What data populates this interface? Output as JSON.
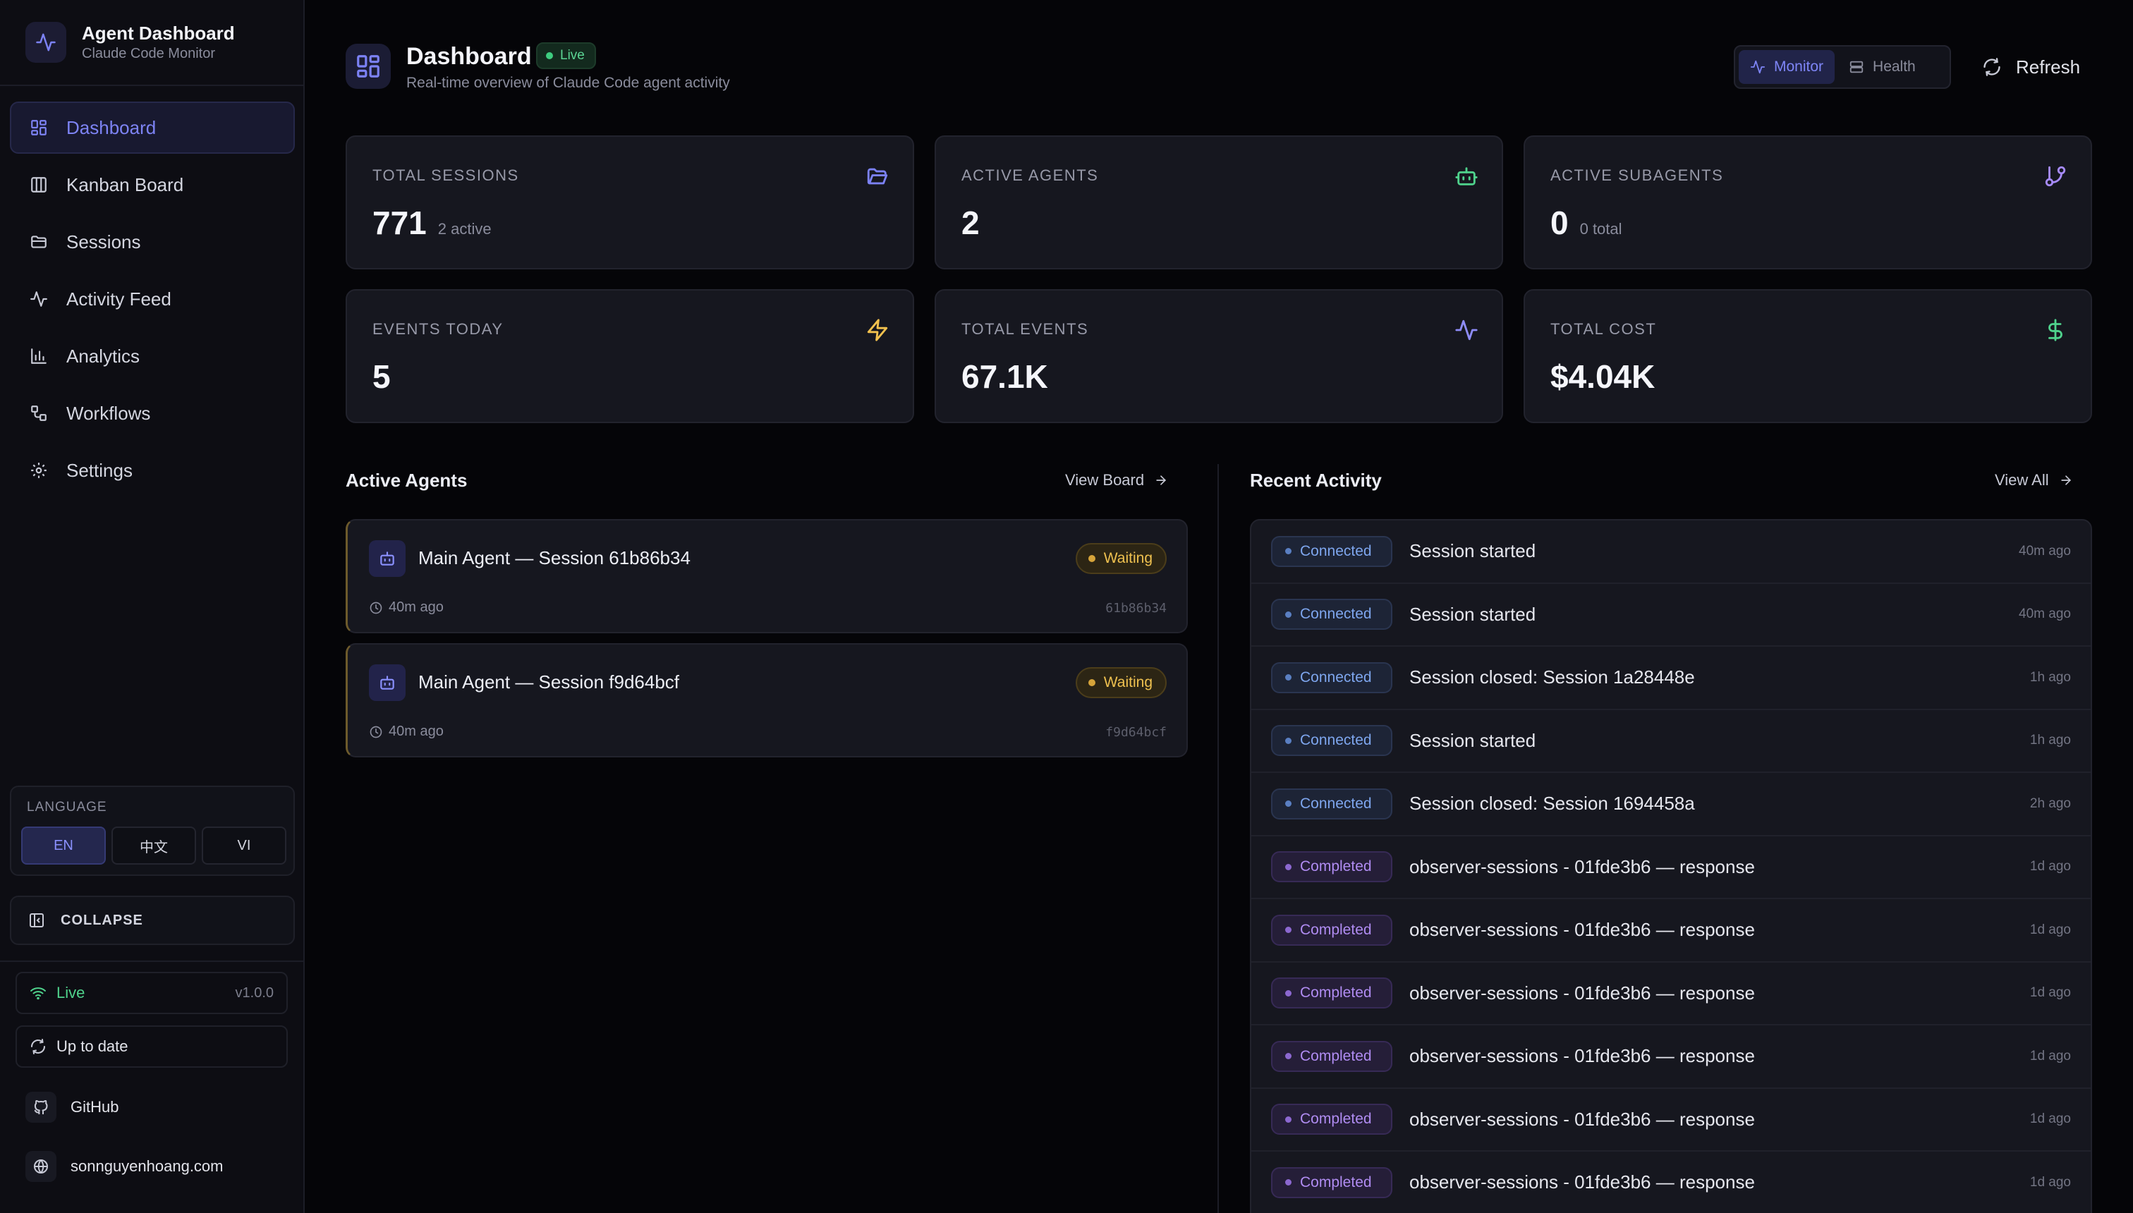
{
  "brand": {
    "title": "Agent Dashboard",
    "subtitle": "Claude Code Monitor"
  },
  "nav": [
    {
      "label": "Dashboard",
      "icon": "layout-grid-icon",
      "active": true
    },
    {
      "label": "Kanban Board",
      "icon": "columns-icon",
      "active": false
    },
    {
      "label": "Sessions",
      "icon": "folder-icon",
      "active": false
    },
    {
      "label": "Activity Feed",
      "icon": "activity-icon",
      "active": false
    },
    {
      "label": "Analytics",
      "icon": "bar-chart-icon",
      "active": false
    },
    {
      "label": "Workflows",
      "icon": "workflow-icon",
      "active": false
    },
    {
      "label": "Settings",
      "icon": "gear-icon",
      "active": false
    }
  ],
  "language": {
    "title": "LANGUAGE",
    "options": [
      "EN",
      "中文",
      "VI"
    ],
    "selected": "EN"
  },
  "collapse_label": "COLLAPSE",
  "status": {
    "live_label": "Live",
    "version": "v1.0.0",
    "update_label": "Up to date"
  },
  "links": {
    "github": "GitHub",
    "website": "sonnguyenhoang.com"
  },
  "header": {
    "title": "Dashboard",
    "live_badge": "Live",
    "subtitle": "Real-time overview of Claude Code agent activity",
    "toggle": {
      "monitor": "Monitor",
      "health": "Health",
      "selected": "Monitor"
    },
    "refresh": "Refresh"
  },
  "stats": [
    {
      "label": "TOTAL SESSIONS",
      "value": "771",
      "sub": "2 active",
      "icon": "folder-open-icon",
      "color": "#7c82f5"
    },
    {
      "label": "ACTIVE AGENTS",
      "value": "2",
      "sub": "",
      "icon": "bot-icon",
      "color": "#4fd28c"
    },
    {
      "label": "ACTIVE SUBAGENTS",
      "value": "0",
      "sub": "0 total",
      "icon": "git-branch-icon",
      "color": "#a78bfa"
    },
    {
      "label": "EVENTS TODAY",
      "value": "5",
      "sub": "",
      "icon": "zap-icon",
      "color": "#f2c14e"
    },
    {
      "label": "TOTAL EVENTS",
      "value": "67.1K",
      "sub": "",
      "icon": "activity-icon",
      "color": "#8e8cf8"
    },
    {
      "label": "TOTAL COST",
      "value": "$4.04K",
      "sub": "",
      "icon": "dollar-icon",
      "color": "#4fd28c"
    }
  ],
  "active_agents": {
    "title": "Active Agents",
    "link": "View Board",
    "items": [
      {
        "name": "Main Agent — Session 61b86b34",
        "status": "Waiting",
        "time": "40m ago",
        "id": "61b86b34"
      },
      {
        "name": "Main Agent — Session f9d64bcf",
        "status": "Waiting",
        "time": "40m ago",
        "id": "f9d64bcf"
      }
    ]
  },
  "recent_activity": {
    "title": "Recent Activity",
    "link": "View All",
    "items": [
      {
        "badge": "Connected",
        "text": "Session started",
        "time": "40m ago"
      },
      {
        "badge": "Connected",
        "text": "Session started",
        "time": "40m ago"
      },
      {
        "badge": "Connected",
        "text": "Session closed: Session 1a28448e",
        "time": "1h ago"
      },
      {
        "badge": "Connected",
        "text": "Session started",
        "time": "1h ago"
      },
      {
        "badge": "Connected",
        "text": "Session closed: Session 1694458a",
        "time": "2h ago"
      },
      {
        "badge": "Completed",
        "text": "observer-sessions - 01fde3b6 — response",
        "time": "1d ago"
      },
      {
        "badge": "Completed",
        "text": "observer-sessions - 01fde3b6 — response",
        "time": "1d ago"
      },
      {
        "badge": "Completed",
        "text": "observer-sessions - 01fde3b6 — response",
        "time": "1d ago"
      },
      {
        "badge": "Completed",
        "text": "observer-sessions - 01fde3b6 — response",
        "time": "1d ago"
      },
      {
        "badge": "Completed",
        "text": "observer-sessions - 01fde3b6 — response",
        "time": "1d ago"
      },
      {
        "badge": "Completed",
        "text": "observer-sessions - 01fde3b6 — response",
        "time": "1d ago"
      }
    ]
  }
}
